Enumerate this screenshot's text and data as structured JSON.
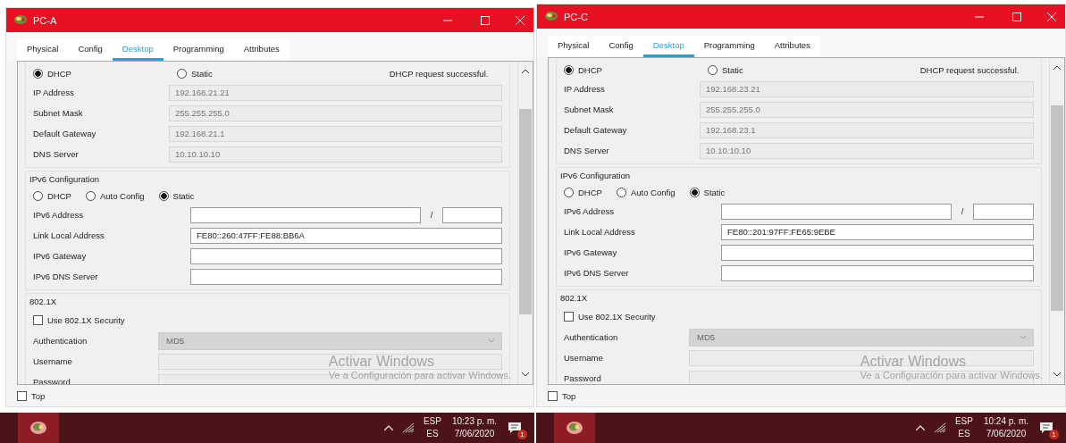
{
  "panes": [
    {
      "window": {
        "title": "PC-A"
      },
      "tabs": [
        {
          "label": "Physical",
          "selected": false
        },
        {
          "label": "Config",
          "selected": false
        },
        {
          "label": "Desktop",
          "selected": true
        },
        {
          "label": "Programming",
          "selected": false
        },
        {
          "label": "Attributes",
          "selected": false
        }
      ],
      "ipv4": {
        "modes": [
          {
            "label": "DHCP",
            "selected": true
          },
          {
            "label": "Static",
            "selected": false
          }
        ],
        "status": "DHCP request successful.",
        "fields": [
          {
            "label": "IP Address",
            "value": "192.168.21.21",
            "disabled": true
          },
          {
            "label": "Subnet Mask",
            "value": "255.255.255.0",
            "disabled": true
          },
          {
            "label": "Default Gateway",
            "value": "192.168.21.1",
            "disabled": true
          },
          {
            "label": "DNS Server",
            "value": "10.10.10.10",
            "disabled": true
          }
        ]
      },
      "ipv6": {
        "title": "IPv6 Configuration",
        "modes": [
          {
            "label": "DHCP",
            "selected": false
          },
          {
            "label": "Auto Config",
            "selected": false
          },
          {
            "label": "Static",
            "selected": true
          }
        ],
        "address": {
          "label": "IPv6 Address",
          "separator": "/",
          "disabled": false
        },
        "fields": [
          {
            "label": "Link Local Address",
            "value": "FE80::260:47FF:FE88:BB6A",
            "disabled": false
          },
          {
            "label": "IPv6 Gateway",
            "disabled": false
          },
          {
            "label": "IPv6 DNS Server",
            "disabled": false
          }
        ]
      },
      "security": {
        "title": "802.1X",
        "use": {
          "label": "Use 802.1X Security",
          "checked": false
        },
        "authentication": {
          "label": "Authentication",
          "value": "MD5",
          "disabled": true
        },
        "fields": [
          {
            "label": "Username",
            "disabled": true
          },
          {
            "label": "Password",
            "disabled": true
          }
        ]
      },
      "watermark": {
        "title": "Activar Windows",
        "subtitle": "Ve a Configuración para activar Windows."
      },
      "top": {
        "label": "Top",
        "checked": false
      },
      "taskbar": {
        "language": "ESP",
        "layout": "ES",
        "time": "10:23 p. m.",
        "date": "7/06/2020",
        "notifications": "1"
      }
    },
    {
      "window": {
        "title": "PC-C"
      },
      "tabs": [
        {
          "label": "Physical",
          "selected": false
        },
        {
          "label": "Config",
          "selected": false
        },
        {
          "label": "Desktop",
          "selected": true
        },
        {
          "label": "Programming",
          "selected": false
        },
        {
          "label": "Attributes",
          "selected": false
        }
      ],
      "ipv4": {
        "modes": [
          {
            "label": "DHCP",
            "selected": true
          },
          {
            "label": "Static",
            "selected": false
          }
        ],
        "status": "DHCP request successful.",
        "fields": [
          {
            "label": "IP Address",
            "value": "192.168.23.21",
            "disabled": true
          },
          {
            "label": "Subnet Mask",
            "value": "255.255.255.0",
            "disabled": true
          },
          {
            "label": "Default Gateway",
            "value": "192.168.23.1",
            "disabled": true
          },
          {
            "label": "DNS Server",
            "value": "10.10.10.10",
            "disabled": true
          }
        ]
      },
      "ipv6": {
        "title": "IPv6 Configuration",
        "modes": [
          {
            "label": "DHCP",
            "selected": false
          },
          {
            "label": "Auto Config",
            "selected": false
          },
          {
            "label": "Static",
            "selected": true
          }
        ],
        "address": {
          "label": "IPv6 Address",
          "separator": "/",
          "disabled": false
        },
        "fields": [
          {
            "label": "Link Local Address",
            "value": "FE80::201:97FF:FE65:9EBE",
            "disabled": false
          },
          {
            "label": "IPv6 Gateway",
            "disabled": false
          },
          {
            "label": "IPv6 DNS Server",
            "disabled": false
          }
        ]
      },
      "security": {
        "title": "802.1X",
        "use": {
          "label": "Use 802.1X Security",
          "checked": false
        },
        "authentication": {
          "label": "Authentication",
          "value": "MD5",
          "disabled": true
        },
        "fields": [
          {
            "label": "Username",
            "disabled": true
          },
          {
            "label": "Password",
            "disabled": true
          }
        ]
      },
      "watermark": {
        "title": "Activar Windows",
        "subtitle": "Ve a Configuración para activar Windows."
      },
      "top": {
        "label": "Top",
        "checked": false
      },
      "taskbar": {
        "language": "ESP",
        "layout": "ES",
        "time": "10:24 p. m.",
        "date": "7/06/2020",
        "notifications": "1"
      }
    }
  ]
}
